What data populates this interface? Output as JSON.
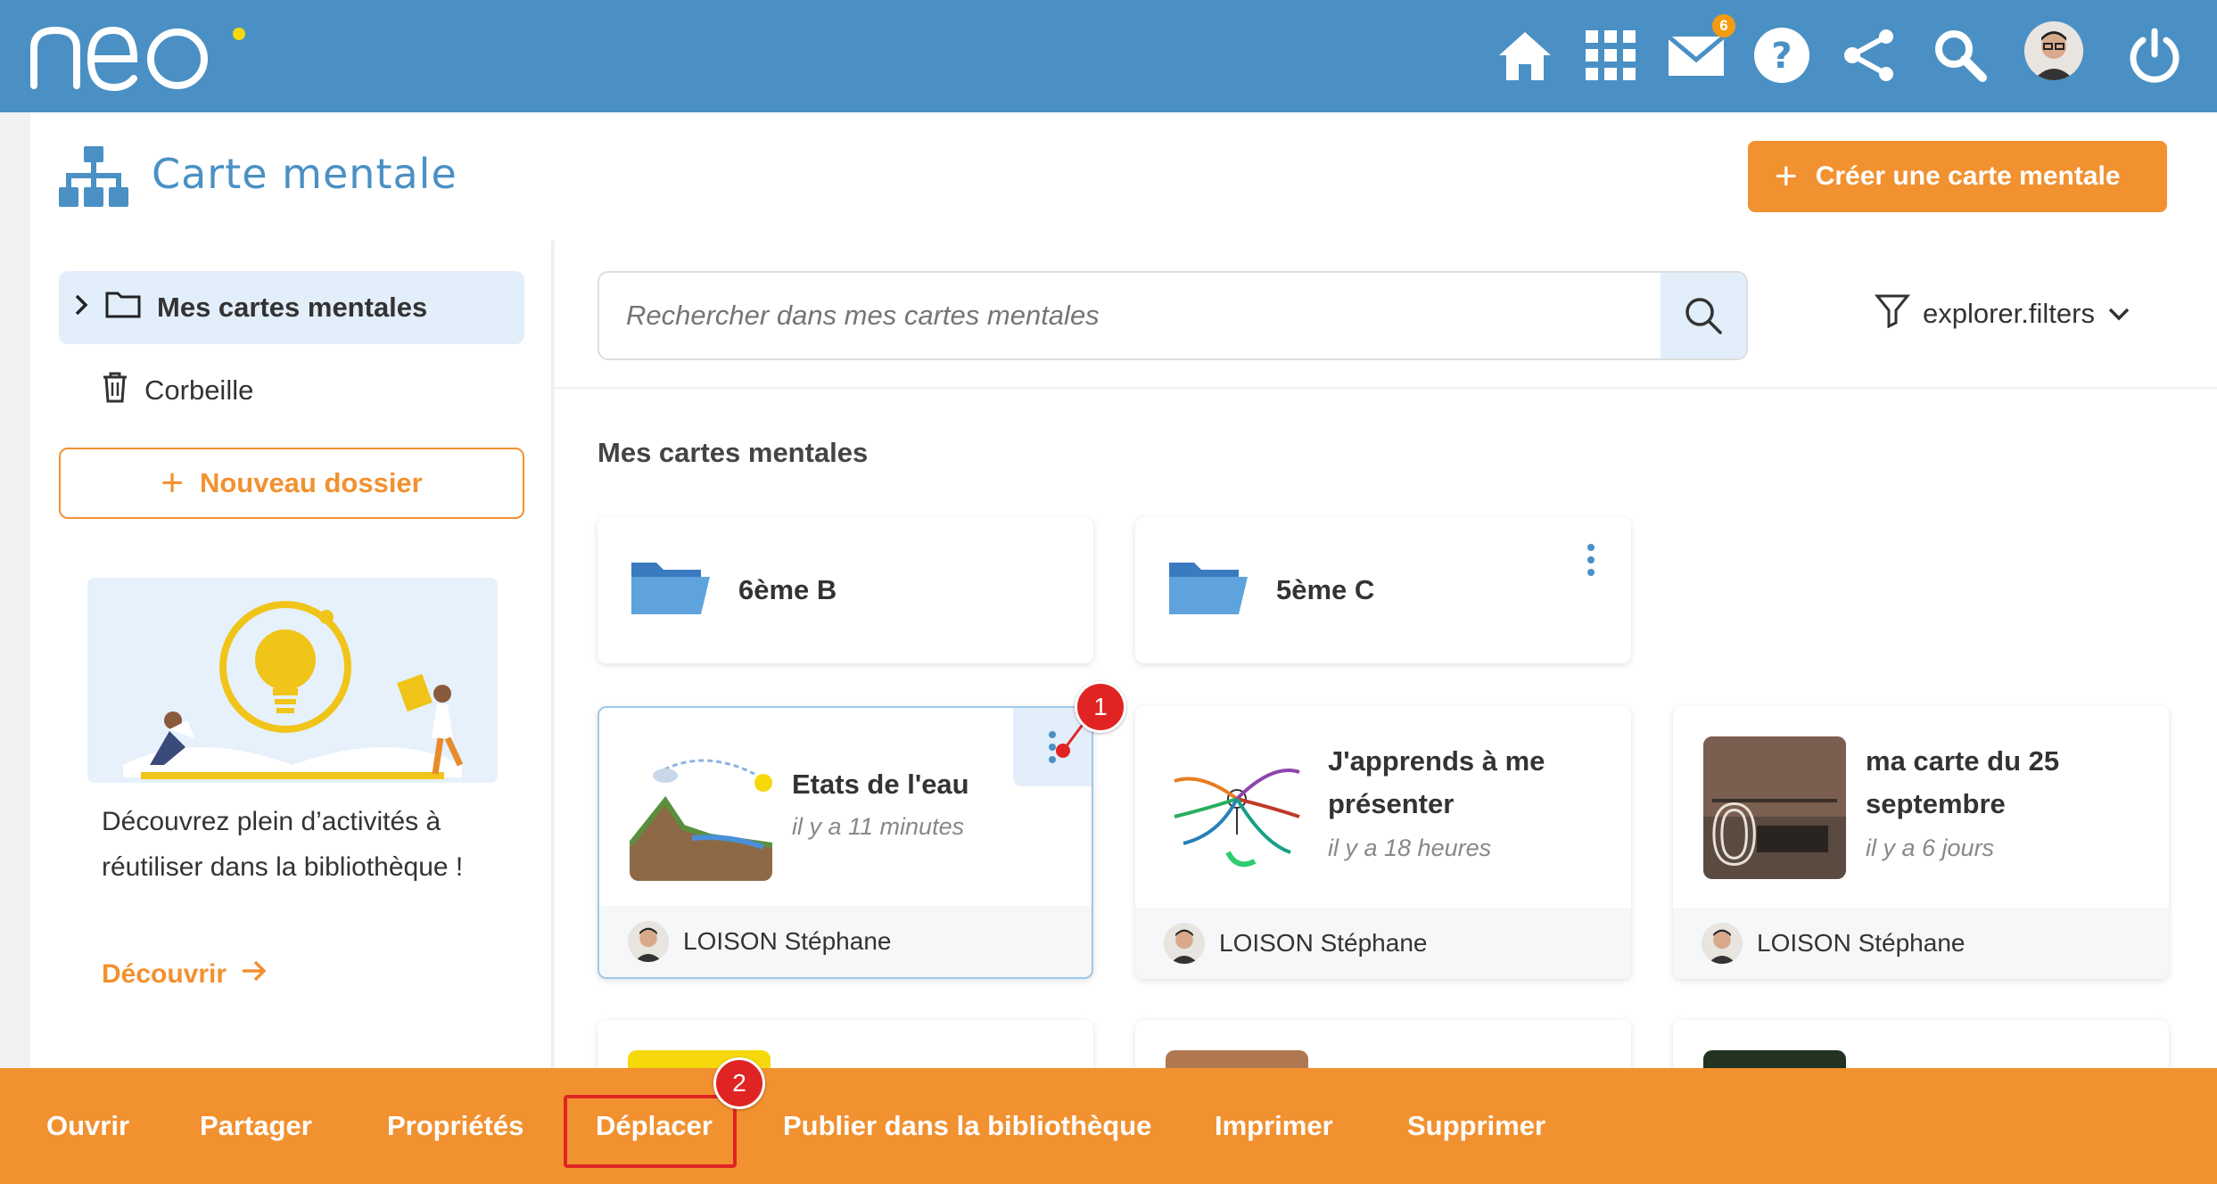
{
  "header": {
    "brand": "neo",
    "mail_count": "6",
    "icons": [
      "home-icon",
      "apps-grid-icon",
      "mail-icon",
      "help-icon",
      "share-network-icon",
      "search-icon",
      "user-avatar",
      "power-icon"
    ]
  },
  "app": {
    "title": "Carte mentale",
    "create_button": "Créer une carte mentale"
  },
  "sidebar": {
    "tree_root": "Mes cartes mentales",
    "trash": "Corbeille",
    "new_folder": "Nouveau dossier",
    "promo_text": "Découvrez plein d’activités à réutiliser dans la bibliothèque !",
    "promo_link": "Découvrir"
  },
  "search": {
    "placeholder": "Rechercher dans mes cartes mentales",
    "filters_label": "explorer.filters"
  },
  "main": {
    "section_title": "Mes cartes mentales",
    "folders": [
      {
        "name": "6ème B"
      },
      {
        "name": "5ème C"
      }
    ],
    "resources": [
      {
        "title": "Etats de l'eau",
        "time": "il y a 11 minutes",
        "author": "LOISON Stéphane"
      },
      {
        "title": "J'apprends à me présenter",
        "time": "il y a 18 heures",
        "author": "LOISON Stéphane"
      },
      {
        "title": "ma carte du 25 septembre",
        "time": "il y a 6 jours",
        "author": "LOISON Stéphane"
      }
    ]
  },
  "markers": [
    "1",
    "2"
  ],
  "actions": [
    "Ouvrir",
    "Partager",
    "Propriétés",
    "Déplacer",
    "Publier dans la bibliothèque",
    "Imprimer",
    "Supprimer"
  ],
  "colors": {
    "header_blue": "#4a90c4",
    "accent_orange": "#f29130",
    "selection_blue": "#e3eefb",
    "marker_red": "#e02424"
  }
}
